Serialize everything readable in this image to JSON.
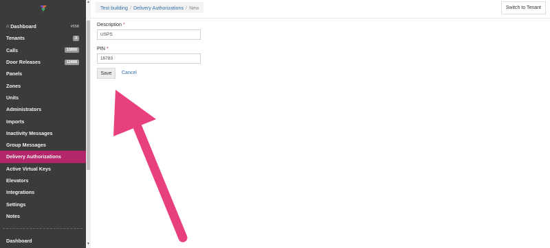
{
  "sidebar": {
    "items": [
      {
        "label": "Dashboard",
        "count": "#558"
      },
      {
        "label": "Tenants",
        "badge": "3"
      },
      {
        "label": "Calls",
        "badge": "13890"
      },
      {
        "label": "Door Releases",
        "badge": "12688"
      },
      {
        "label": "Panels"
      },
      {
        "label": "Zones"
      },
      {
        "label": "Units"
      },
      {
        "label": "Administrators"
      },
      {
        "label": "Imports"
      },
      {
        "label": "Inactivity Messages"
      },
      {
        "label": "Group Messages"
      },
      {
        "label": "Delivery Authorizations",
        "active": true
      },
      {
        "label": "Active Virtual Keys"
      },
      {
        "label": "Elevators"
      },
      {
        "label": "Integrations"
      },
      {
        "label": "Settings"
      },
      {
        "label": "Notes"
      }
    ],
    "bottom_label": "Dashboard"
  },
  "breadcrumb": {
    "building": "Test building",
    "section": "Delivery Authorizations",
    "current": "New",
    "separator": "/"
  },
  "header": {
    "switch_label": "Switch to Tenant"
  },
  "form": {
    "description_label": "Description",
    "description_value": "USPS",
    "pin_label": "PIN",
    "pin_value": "16783",
    "required_mark": "*",
    "save_label": "Save",
    "cancel_label": "Cancel"
  },
  "colors": {
    "active_nav": "#b3266a",
    "arrow": "#e8407f",
    "link": "#2f6ea8"
  }
}
